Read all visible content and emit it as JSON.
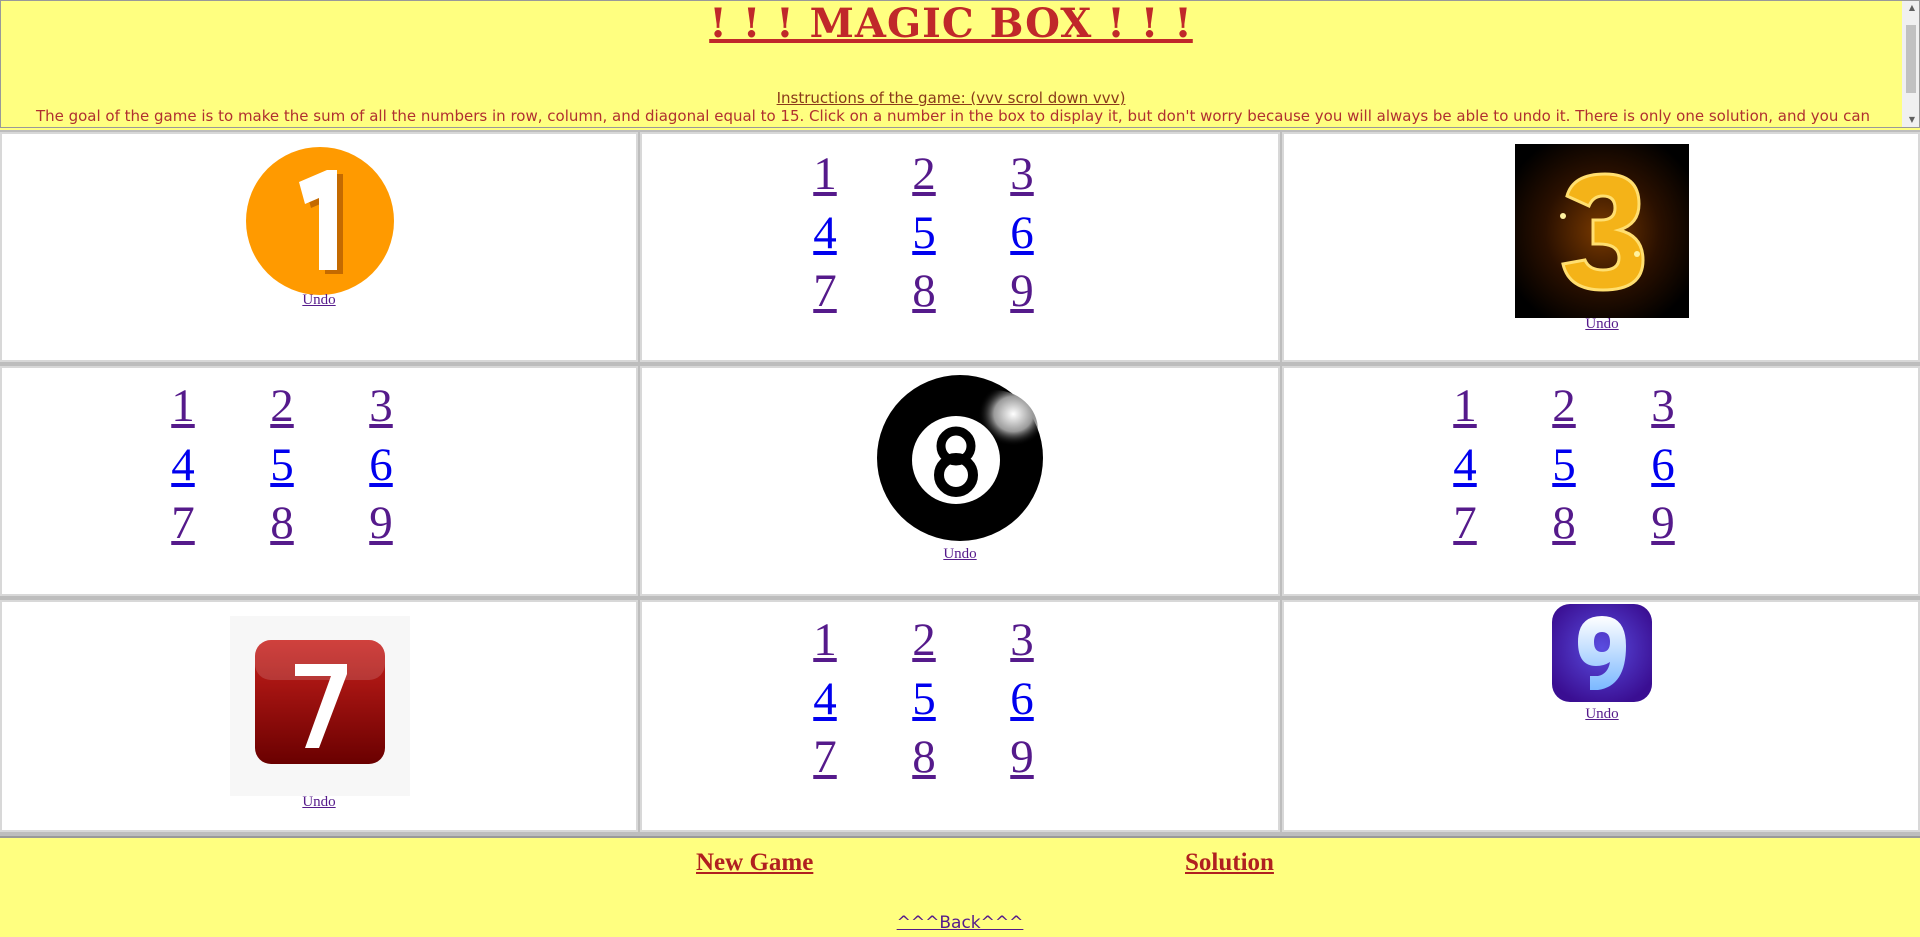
{
  "header": {
    "title": "! ! ! MAGIC BOX ! ! !",
    "instructions_link": "Instructions of the game: (vvv scrol down vvv)",
    "instructions_text": "The goal of the game is to make the sum of all the numbers in row, column, and diagonal equal to 15. Click on a number in the box to display it, but don't worry because you will always be able to undo it. There is only one solution, and you can"
  },
  "board": {
    "number_options": [
      "1",
      "2",
      "3",
      "4",
      "5",
      "6",
      "7",
      "8",
      "9"
    ],
    "undo_label": "Undo",
    "cells": [
      {
        "state": "filled",
        "value": 1,
        "icon": "orange-circle-one-icon"
      },
      {
        "state": "empty"
      },
      {
        "state": "filled",
        "value": 3,
        "icon": "golden-three-icon"
      },
      {
        "state": "empty"
      },
      {
        "state": "filled",
        "value": 8,
        "icon": "eight-ball-icon"
      },
      {
        "state": "empty"
      },
      {
        "state": "filled",
        "value": 7,
        "icon": "red-seven-tile-icon"
      },
      {
        "state": "empty"
      },
      {
        "state": "filled",
        "value": 9,
        "icon": "blue-nine-tile-icon"
      }
    ],
    "colors": {
      "visited_link": "#551a8b",
      "unvisited_link": "#0000ee"
    }
  },
  "footer": {
    "new_game": "New Game",
    "solution": "Solution",
    "back": "^^^Back^^^"
  },
  "colors": {
    "page_background": "#ffff80",
    "title": "#c0282a",
    "instructions_text": "#b03030",
    "footer_links": "#b02020"
  },
  "icons": {
    "scroll_up": "▲",
    "scroll_down": "▼"
  }
}
